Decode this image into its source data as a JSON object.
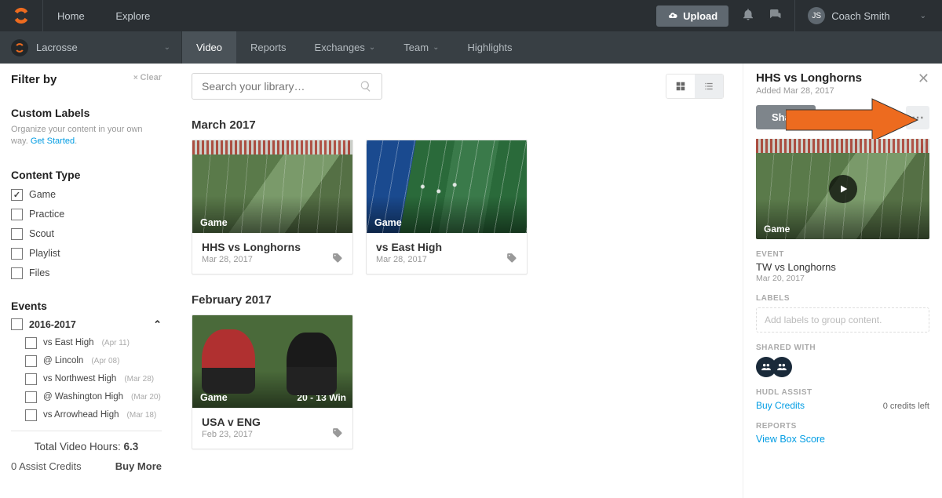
{
  "topbar": {
    "nav": {
      "home": "Home",
      "explore": "Explore"
    },
    "upload_label": "Upload",
    "user": {
      "initials": "JS",
      "name": "Coach Smith"
    }
  },
  "subbar": {
    "team_name": "Lacrosse",
    "tabs": {
      "video": "Video",
      "reports": "Reports",
      "exchanges": "Exchanges",
      "team": "Team",
      "highlights": "Highlights"
    }
  },
  "sidebar": {
    "title": "Filter by",
    "clear": "Clear",
    "custom_labels": {
      "heading": "Custom Labels",
      "desc": "Organize your content in your own way.",
      "get_started": "Get Started"
    },
    "content_type": {
      "heading": "Content Type",
      "items": [
        {
          "label": "Game",
          "checked": true
        },
        {
          "label": "Practice",
          "checked": false
        },
        {
          "label": "Scout",
          "checked": false
        },
        {
          "label": "Playlist",
          "checked": false
        },
        {
          "label": "Files",
          "checked": false
        }
      ]
    },
    "events": {
      "heading": "Events",
      "year": "2016-2017",
      "items": [
        {
          "label": "vs East High",
          "date": "(Apr 11)"
        },
        {
          "label": "@ Lincoln",
          "date": "(Apr 08)"
        },
        {
          "label": "vs Northwest High",
          "date": "(Mar 28)"
        },
        {
          "label": "@ Washington High",
          "date": "(Mar 20)"
        },
        {
          "label": "vs Arrowhead High",
          "date": "(Mar 18)"
        }
      ]
    },
    "stats": {
      "video_hours_label": "Total Video Hours: ",
      "video_hours": "6.3",
      "assist_credits": "0 Assist Credits",
      "buy_more": "Buy More"
    }
  },
  "main": {
    "search_placeholder": "Search your library…",
    "sections": [
      {
        "month": "March 2017",
        "cards": [
          {
            "badge": "Game",
            "title": "HHS vs Longhorns",
            "date": "Mar 28, 2017",
            "thumb": "thumb1"
          },
          {
            "badge": "Game",
            "title": "vs East High",
            "date": "Mar 28, 2017",
            "thumb": "thumb2"
          }
        ]
      },
      {
        "month": "February 2017",
        "cards": [
          {
            "badge": "Game",
            "title": "USA v ENG",
            "date": "Feb 23, 2017",
            "thumb": "thumb3",
            "winbadge": "20 - 13 Win"
          }
        ]
      }
    ]
  },
  "detail": {
    "title": "HHS vs Longhorns",
    "added": "Added Mar 28, 2017",
    "share": "Share",
    "thumb_badge": "Game",
    "event": {
      "label": "EVENT",
      "value": "TW vs Longhorns",
      "date": "Mar 20, 2017"
    },
    "labels": {
      "label": "LABELS",
      "placeholder_a": "Add labels",
      "placeholder_b": " to group content."
    },
    "shared_with": "SHARED WITH",
    "hudl_assist": {
      "label": "HUDL ASSIST",
      "buy": "Buy Credits",
      "credits": "0 credits left"
    },
    "reports": {
      "label": "REPORTS",
      "view": "View Box Score"
    }
  }
}
